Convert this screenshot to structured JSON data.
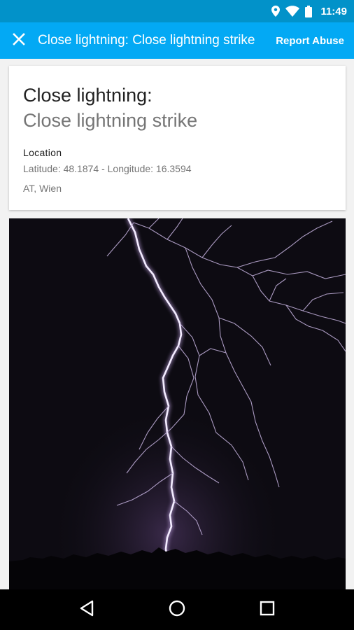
{
  "status_bar": {
    "time": "11:49",
    "icons": [
      "location-icon",
      "wifi-icon",
      "battery-icon"
    ]
  },
  "app_bar": {
    "title": "Close lightning: Close lightning strike",
    "action_label": "Report Abuse",
    "close_icon": "close-icon"
  },
  "card": {
    "title": "Close lightning:",
    "subtitle": "Close lightning strike",
    "location_label": "Location",
    "coordinates": "Latitude: 48.1874 - Longitude: 16.3594",
    "place": "AT, Wien"
  },
  "photo": {
    "subject": "lightning strike at night"
  },
  "nav_bar": {
    "icons": [
      "back-icon",
      "home-icon",
      "recents-icon"
    ]
  },
  "colors": {
    "status_bar": "#0292c9",
    "app_bar": "#03a9f4",
    "card_bg": "#ffffff",
    "page_bg": "#f2f2f2"
  }
}
